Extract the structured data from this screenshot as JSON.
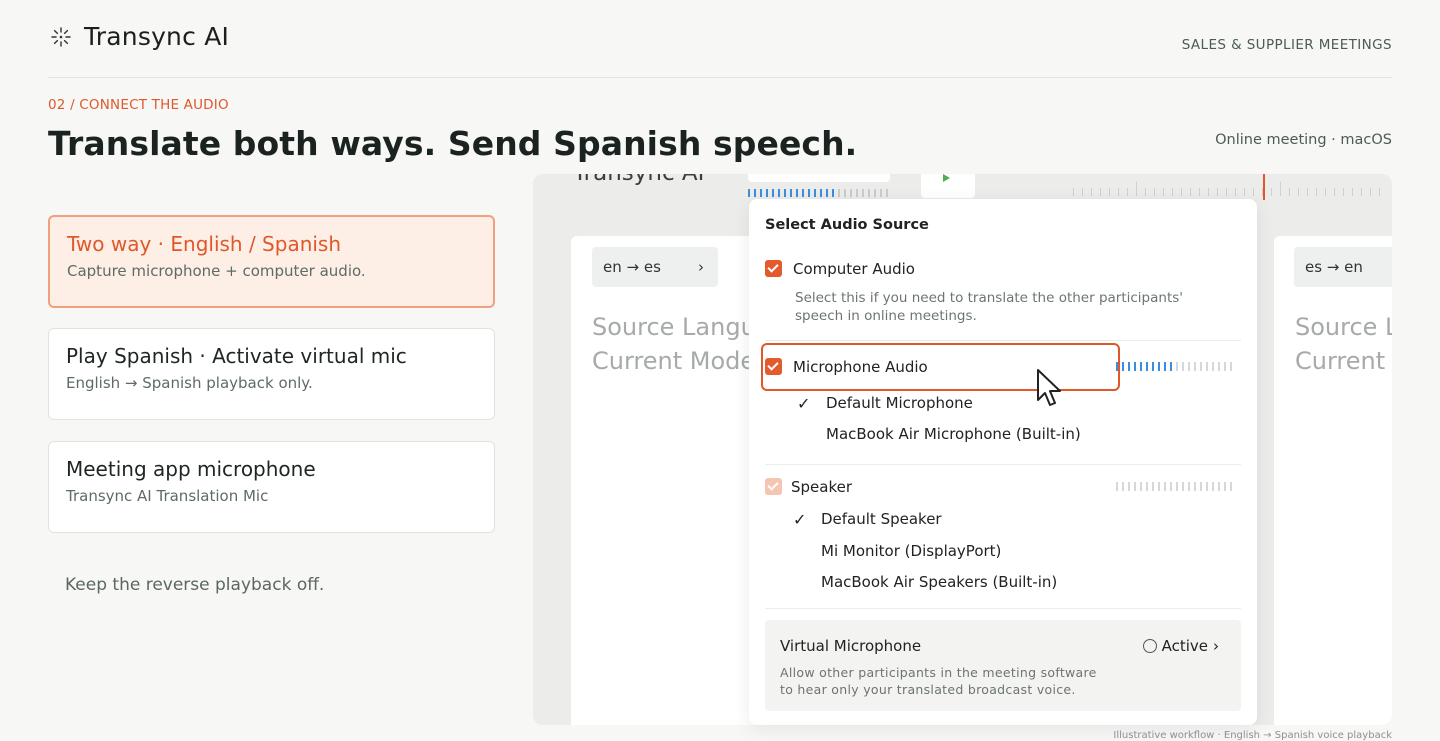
{
  "brand": {
    "name": "Transync AI",
    "icon": "sparkle-grid-icon"
  },
  "header": {
    "tag": "SALES & SUPPLIER MEETINGS"
  },
  "step": "02 / CONNECT THE AUDIO",
  "headline": "Translate both ways. Send Spanish speech.",
  "meta": "Online meeting · macOS",
  "options": [
    {
      "title": "Two way · English / Spanish",
      "sub": "Capture microphone + computer audio."
    },
    {
      "title": "Play Spanish · Activate virtual mic",
      "sub": "English → Spanish playback only."
    },
    {
      "title": "Meeting app microphone",
      "sub": "Transync AI Translation Mic"
    }
  ],
  "note": "Keep the reverse playback off.",
  "mock": {
    "app_title": "Transync AI",
    "left_panel": {
      "lang": "en → es",
      "placeholder_1": "Source Langu",
      "placeholder_2": "Current Mode"
    },
    "right_panel": {
      "lang": "es → en",
      "placeholder_1": "Source L",
      "placeholder_2": "Current M"
    }
  },
  "popover": {
    "title": "Select Audio Source",
    "computer_audio": {
      "label": "Computer Audio",
      "checked": true,
      "desc_1": "Select this if you need to translate the other participants'",
      "desc_2": "speech in online meetings."
    },
    "microphone_audio": {
      "label": "Microphone Audio",
      "checked": true,
      "level": 0.35
    },
    "microphones": [
      {
        "name": "Default Microphone",
        "selected": true
      },
      {
        "name": "MacBook Air Microphone (Built-in)",
        "selected": false
      }
    ],
    "speaker": {
      "label": "Speaker",
      "checked": true,
      "disabled": true
    },
    "speakers": [
      {
        "name": "Default Speaker",
        "selected": true
      },
      {
        "name": "Mi Monitor (DisplayPort)",
        "selected": false
      },
      {
        "name": "MacBook Air Speakers (Built-in)",
        "selected": false
      }
    ],
    "virtual_mic": {
      "title": "Virtual Microphone",
      "status": "Active",
      "desc_1": "Allow other participants in the meeting software",
      "desc_2": "to hear only your translated broadcast voice."
    }
  },
  "caption": "Illustrative workflow · English → Spanish voice playback",
  "colors": {
    "accent": "#e0582a",
    "meter": "#3a8ee0"
  }
}
